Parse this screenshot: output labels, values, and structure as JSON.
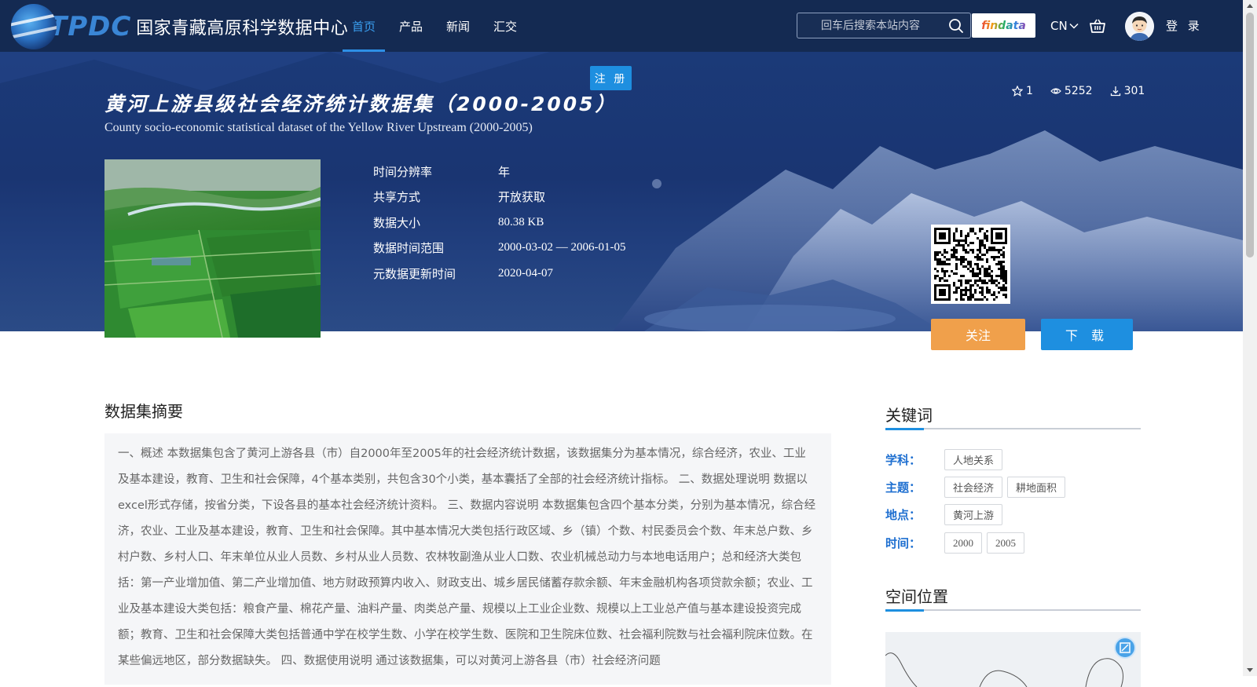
{
  "header": {
    "logo_abbr": "TPDC",
    "logo_name": "国家青藏高原科学数据中心",
    "nav": [
      {
        "label": "首页",
        "active": true
      },
      {
        "label": "产品",
        "active": false
      },
      {
        "label": "新闻",
        "active": false
      },
      {
        "label": "汇交",
        "active": false
      }
    ],
    "search_placeholder": "回车后搜索本站内容",
    "findata_label": "findata",
    "lang": "CN",
    "login": "登 录",
    "register": "注 册"
  },
  "dataset": {
    "title_cn": "黄河上游县级社会经济统计数据集（2000-2005）",
    "title_en": "County socio-economic statistical dataset of the Yellow River Upstream (2000-2005)",
    "stats": {
      "stars": "1",
      "views": "5252",
      "downloads": "301"
    },
    "meta": [
      {
        "key": "时间分辨率",
        "value": "年"
      },
      {
        "key": "共享方式",
        "value": "开放获取"
      },
      {
        "key": "数据大小",
        "value": "80.38 KB"
      },
      {
        "key": "数据时间范围",
        "value": "2000-03-02 — 2006-01-05"
      },
      {
        "key": "元数据更新时间",
        "value": "2020-04-07"
      }
    ],
    "follow_label": "关注",
    "download_label": "下 载"
  },
  "abstract": {
    "title": "数据集摘要",
    "text": "一、概述 本数据集包含了黄河上游各县（市）自2000年至2005年的社会经济统计数据，该数据集分为基本情况，综合经济，农业、工业及基本建设，教育、卫生和社会保障，4个基本类别，共包含30个小类，基本囊括了全部的社会经济统计指标。 二、数据处理说明 数据以excel形式存储，按省分类，下设各县的基本社会经济统计资料。 三、数据内容说明 本数据集包含四个基本分类，分别为基本情况，综合经济，农业、工业及基本建设，教育、卫生和社会保障。其中基本情况大类包括行政区域、乡（镇）个数、村民委员会个数、年末总户数、乡村户数、乡村人口、年末单位从业人员数、乡村从业人员数、农林牧副渔从业人口数、农业机械总动力与本地电话用户；总和经济大类包括：第一产业增加值、第二产业增加值、地方财政预算内收入、财政支出、城乡居民储蓄存款余额、年末金融机构各项贷款余额；农业、工业及基本建设大类包括：粮食产量、棉花产量、油料产量、肉类总产量、规模以上工业企业数、规模以上工业总产值与基本建设投资完成额；教育、卫生和社会保障大类包括普通中学在校学生数、小学在校学生数、医院和卫生院床位数、社会福利院数与社会福利院床位数。在某些偏远地区，部分数据缺失。 四、数据使用说明 通过该数据集，可以对黄河上游各县（市）社会经济问题"
  },
  "keywords": {
    "title": "关键词",
    "rows": [
      {
        "label": "学科：",
        "tags": [
          "人地关系"
        ]
      },
      {
        "label": "主题：",
        "tags": [
          "社会经济",
          "耕地面积"
        ]
      },
      {
        "label": "地点：",
        "tags": [
          "黄河上游"
        ]
      },
      {
        "label": "时间：",
        "tags": [
          "2000",
          "2005"
        ]
      }
    ]
  },
  "location": {
    "title": "空间位置"
  },
  "colors": {
    "header_bg": "#142a52",
    "accent_blue": "#1e8fe0",
    "follow_orange": "#f0a04b",
    "keyword_label": "#1e6fd0"
  }
}
